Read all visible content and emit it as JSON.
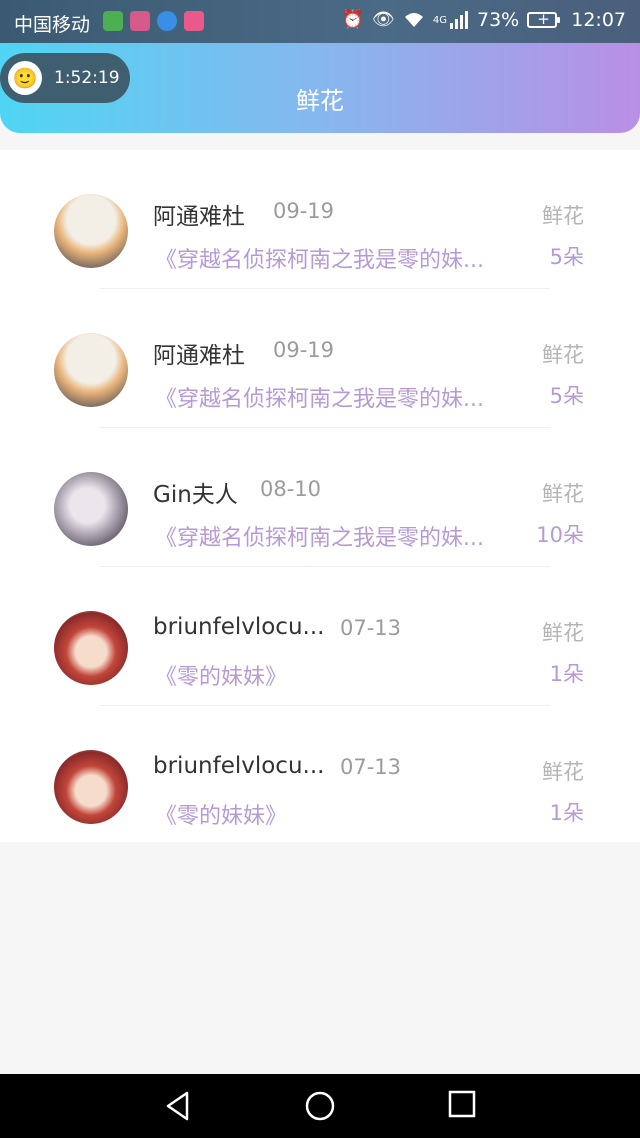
{
  "status_bar": {
    "carrier": "中国移动",
    "network": "4G",
    "battery": "73%",
    "time": "12:07",
    "icons": [
      "alarm-icon",
      "eye-icon",
      "wifi-icon",
      "signal-icon",
      "battery-icon"
    ]
  },
  "header": {
    "title": "鲜花",
    "timer": "1:52:19"
  },
  "gift_label": "鲜花",
  "rows": [
    {
      "name": "阿通难杜",
      "date": "09-19",
      "book": "《穿越名侦探柯南之我是零的妹...",
      "count": "5朵"
    },
    {
      "name": "阿通难杜",
      "date": "09-19",
      "book": "《穿越名侦探柯南之我是零的妹...",
      "count": "5朵"
    },
    {
      "name": "Gin夫人",
      "date": "08-10",
      "book": "《穿越名侦探柯南之我是零的妹...",
      "count": "10朵"
    },
    {
      "name": "briunfelvlocu...",
      "date": "07-13",
      "book": "《零的妹妹》",
      "count": "1朵"
    },
    {
      "name": "briunfelvlocu...",
      "date": "07-13",
      "book": "《零的妹妹》",
      "count": "1朵"
    }
  ],
  "colors": {
    "accent_purple": "#b79ad5",
    "header_gradient_start": "#4fd5f3",
    "header_gradient_end": "#b98fe6"
  }
}
